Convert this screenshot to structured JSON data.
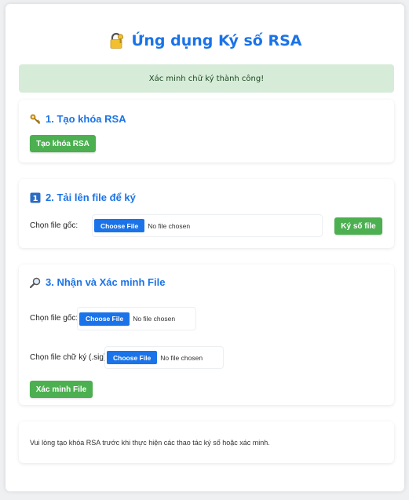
{
  "header": {
    "title": "Ứng dụng Ký số RSA",
    "title_icon": "lock-with-key-icon"
  },
  "alert": {
    "message": "Xác minh chữ ký thành công!",
    "color": "#d6ecd8"
  },
  "section1": {
    "title": "1. Tạo khóa RSA",
    "icon": "key-icon",
    "button_label": "Tạo khóa RSA"
  },
  "section2": {
    "title": "2. Tải lên file để ký",
    "icon": "keycap-one-icon",
    "field_label": "Chọn file gốc:",
    "choose_label": "Choose File",
    "no_file_text": "No file chosen",
    "button_label": "Ký số file"
  },
  "section3": {
    "title": "3. Nhận và Xác minh File",
    "icon": "magnifier-icon",
    "original_label": "Chọn file gốc:",
    "signature_label": "Chọn file chữ ký (.sig):",
    "choose_label": "Choose File",
    "no_file_text": "No file chosen",
    "button_label": "Xác minh File"
  },
  "info": {
    "message": "Vui lòng tạo khóa RSA trước khi thực hiện các thao tác ký số hoặc xác minh."
  },
  "colors": {
    "accent": "#1a73e8",
    "button_green": "#4caf50"
  }
}
